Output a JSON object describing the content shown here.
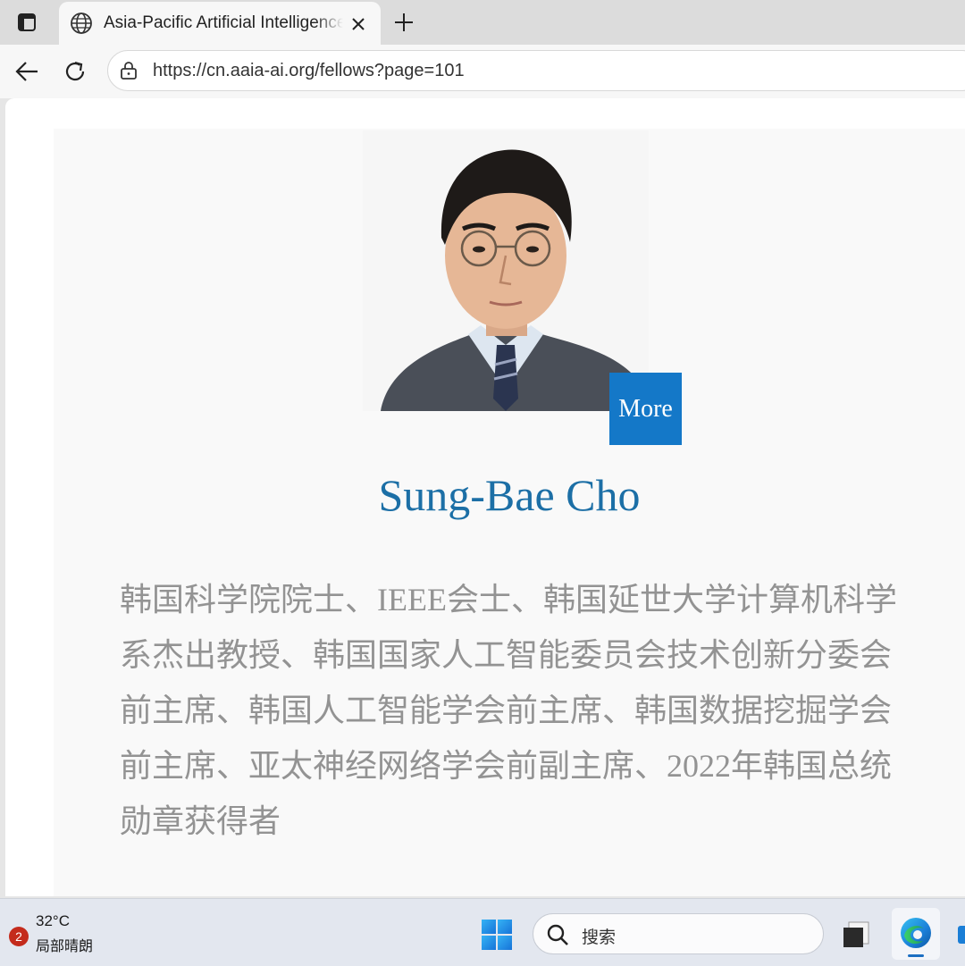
{
  "browser": {
    "tab": {
      "title": "Asia-Pacific Artificial Intelligence Association",
      "favicon": "globe-icon"
    },
    "address_bar": {
      "url": "https://cn.aaia-ai.org/fellows?page=101",
      "security_icon": "lock-icon"
    }
  },
  "fellow": {
    "name": "Sung-Bae Cho",
    "more_label": "More",
    "bio": "韩国科学院院士、IEEE会士、韩国延世大学计算机科学系杰出教授、韩国国家人工智能委员会技术创新分委会前主席、韩国人工智能学会前主席、韩国数据挖掘学会前主席、亚太神经网络学会前副主席、2022年韩国总统勋章获得者"
  },
  "taskbar": {
    "weather": {
      "badge_count": "2",
      "temperature": "32°C",
      "condition": "局部晴朗"
    },
    "search_placeholder": "搜索"
  },
  "colors": {
    "name_blue": "#1c6fa6",
    "more_button_blue": "#1478c8",
    "bio_gray": "#939393",
    "badge_red": "#c42b1c"
  }
}
